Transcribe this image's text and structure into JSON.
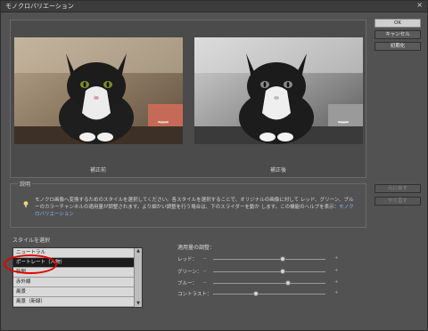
{
  "window": {
    "title": "モノクロバリエーション",
    "close_glyph": "×"
  },
  "buttons": {
    "ok": "OK",
    "cancel": "キャンセル",
    "reset": "初期化",
    "undo": "元に戻す",
    "redo": "やり直す"
  },
  "preview": {
    "before_label": "補正前",
    "after_label": "補正後"
  },
  "description": {
    "label": "説明",
    "text": "モノクロ画像へ変換するためのスタイルを選択してください。各スタイルを選択することで、オリジナルの画像に対して レッド、グリーン、ブルーのカラーチャンネルの適用量が調整されます。より細かい調整を行う場合は、下のスライダーを動か します。この機能のヘルプを表示：",
    "link": "モノクロバリエーション"
  },
  "style_list": {
    "label": "スタイルを選択",
    "items": [
      "ニュートラル",
      "ポートレート（人物）",
      "新聞",
      "赤外線",
      "風景",
      "風景（新緑）"
    ],
    "selected_index": 1
  },
  "adjust": {
    "label": "適用量の調整：",
    "sliders": [
      {
        "name": "レッド：",
        "value": 0.62
      },
      {
        "name": "グリーン：",
        "value": 0.62
      },
      {
        "name": "ブルー：",
        "value": 0.67
      },
      {
        "name": "コントラスト：",
        "value": 0.38
      }
    ],
    "minus": "－",
    "plus": "+"
  },
  "colors": {
    "highlight": "#e10000"
  }
}
